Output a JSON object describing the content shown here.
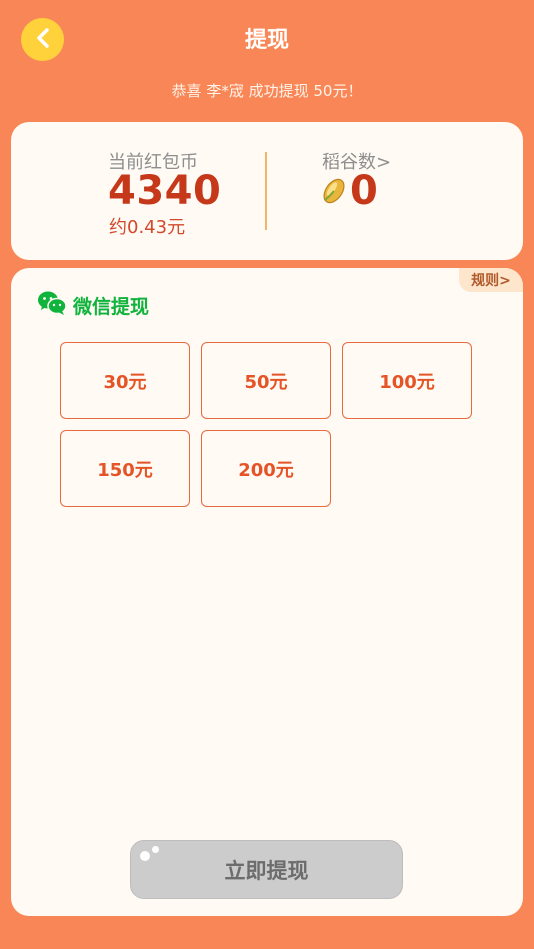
{
  "header": {
    "title": "提现",
    "back_icon": "chevron-left-icon"
  },
  "notice": {
    "text": "恭喜 李*宬 成功提现 50元！"
  },
  "balance": {
    "coin_label": "当前红包币",
    "coin_value": "4340",
    "coin_yuan": "约0.43元",
    "grain_label": "稻谷数>",
    "grain_value": "0",
    "grain_icon": "rice-grain-icon"
  },
  "withdraw": {
    "rules_label": "规则>",
    "method_label": "微信提现",
    "method_icon": "wechat-icon",
    "amounts": [
      "30元",
      "50元",
      "100元",
      "150元",
      "200元"
    ],
    "submit_label": "立即提现"
  },
  "colors": {
    "background": "#F98656",
    "accent": "#E55426",
    "wechat_green": "#10B33C",
    "back_button": "#FFD23C"
  }
}
